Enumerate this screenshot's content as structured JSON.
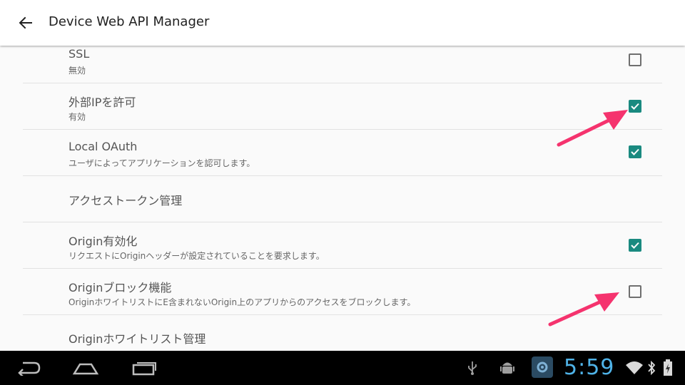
{
  "appbar": {
    "title": "Device Web API Manager",
    "back_icon": "arrow-left-icon"
  },
  "settings": [
    {
      "title": "SSL",
      "summary": "無効",
      "checked": false
    },
    {
      "title": "外部IPを許可",
      "summary": "有効",
      "checked": true
    },
    {
      "title": "Local OAuth",
      "summary": "ユーザによってアプリケーションを認可します。",
      "checked": true
    },
    {
      "category": "アクセストークン管理"
    },
    {
      "title": "Origin有効化",
      "summary": "リクエストにOriginヘッダーが設定されていることを要求します。",
      "checked": true
    },
    {
      "title": "Originブロック機能",
      "summary": "OriginホワイトリストにE含まれないOrigin上のアプリからのアクセスをブロックします。",
      "checked": false
    },
    {
      "category": "Originホワイトリスト管理"
    }
  ],
  "colors": {
    "accent": "#1a8a80",
    "annotation_arrow": "#f5336e",
    "clock": "#4fb3e8"
  },
  "navbar": {
    "back_icon": "nav-back-icon",
    "home_icon": "nav-home-icon",
    "recents_icon": "nav-recents-icon"
  },
  "status": {
    "time": "5:59",
    "icons": [
      "usb-icon",
      "android-debug-icon",
      "app-notification-icon",
      "wifi-icon",
      "bluetooth-icon",
      "battery-charging-icon"
    ]
  }
}
